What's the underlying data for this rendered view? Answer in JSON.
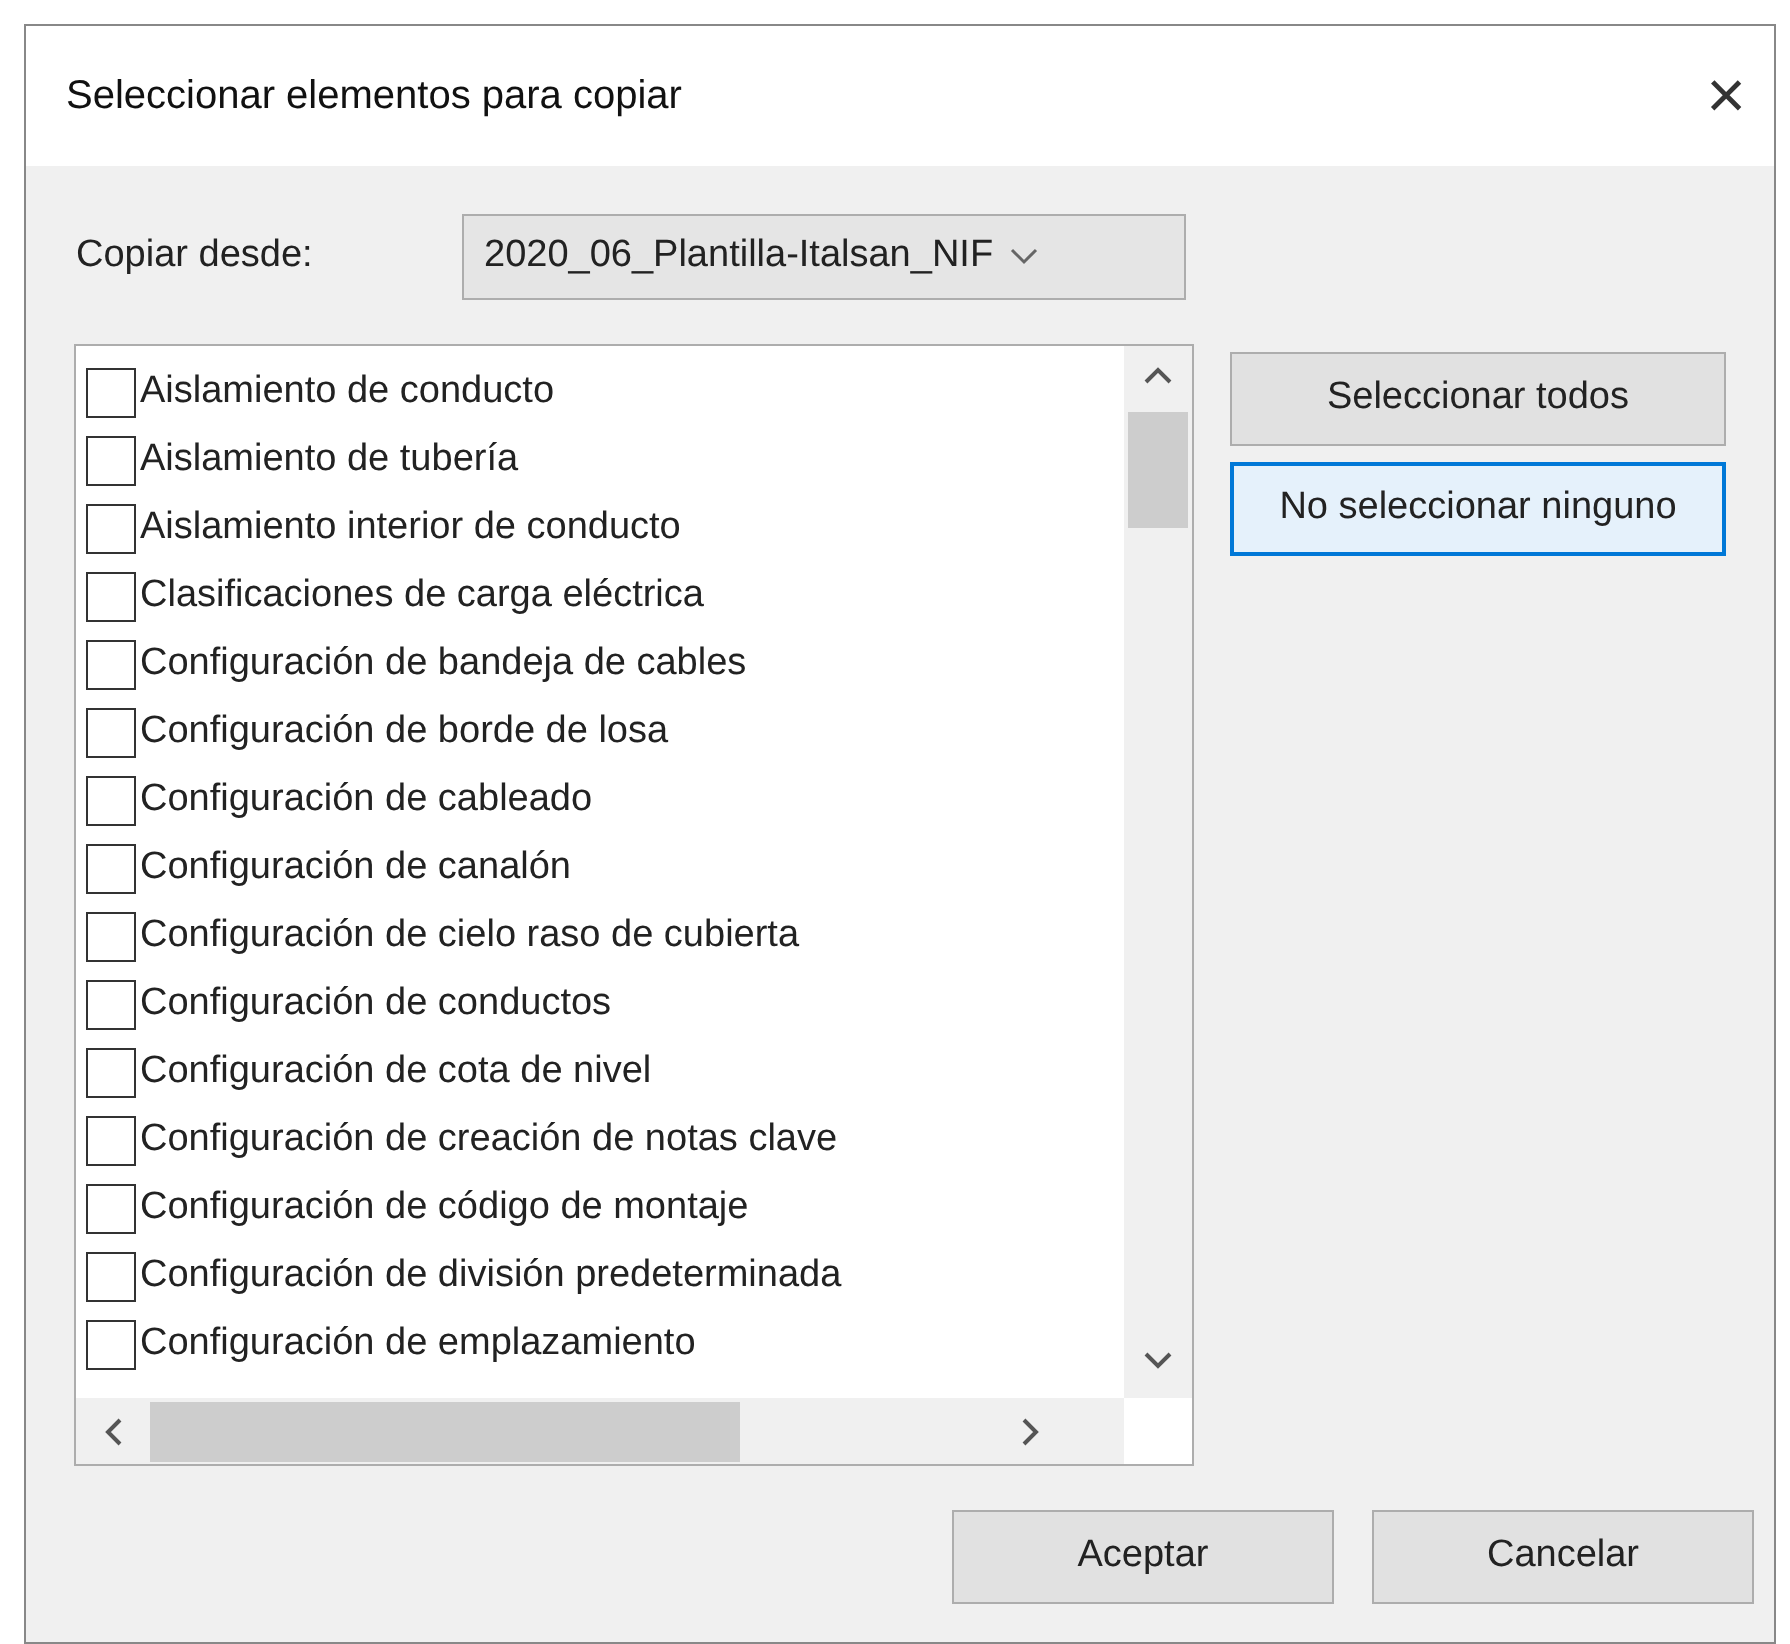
{
  "window": {
    "title": "Seleccionar elementos para copiar",
    "close": "×"
  },
  "source": {
    "label": "Copiar desde:",
    "value": "2020_06_Plantilla-Italsan_NIF"
  },
  "items": [
    {
      "label": "Aislamiento de conducto",
      "checked": false
    },
    {
      "label": "Aislamiento de tubería",
      "checked": false
    },
    {
      "label": "Aislamiento interior de conducto",
      "checked": false
    },
    {
      "label": "Clasificaciones de carga eléctrica",
      "checked": false
    },
    {
      "label": "Configuración de bandeja de cables",
      "checked": false
    },
    {
      "label": "Configuración de borde de losa",
      "checked": false
    },
    {
      "label": "Configuración de cableado",
      "checked": false
    },
    {
      "label": "Configuración de canalón",
      "checked": false
    },
    {
      "label": "Configuración de cielo raso de cubierta",
      "checked": false
    },
    {
      "label": "Configuración de conductos",
      "checked": false
    },
    {
      "label": "Configuración de cota de nivel",
      "checked": false
    },
    {
      "label": "Configuración de creación de notas clave",
      "checked": false
    },
    {
      "label": "Configuración de código de montaje",
      "checked": false
    },
    {
      "label": "Configuración de división predeterminada",
      "checked": false
    },
    {
      "label": "Configuración de emplazamiento",
      "checked": false
    }
  ],
  "side_buttons": [
    {
      "label": "Seleccionar todos",
      "focused": false
    },
    {
      "label": "No seleccionar ninguno",
      "focused": true
    }
  ],
  "footer_buttons": [
    {
      "label": "Aceptar",
      "focused": false
    },
    {
      "label": "Cancelar",
      "focused": false
    }
  ]
}
